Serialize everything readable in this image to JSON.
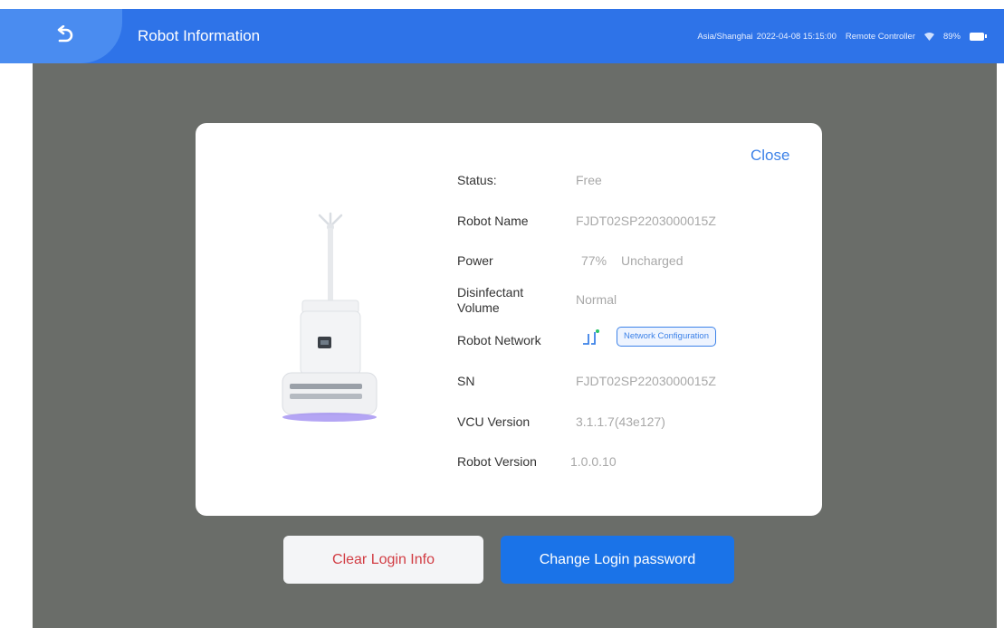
{
  "header": {
    "title": "Robot Information",
    "timezone": "Asia/Shanghai",
    "datetime": "2022-04-08 15:15:00",
    "controller": "Remote Controller",
    "battery": "89%"
  },
  "dialog": {
    "close_label": "Close",
    "status": {
      "label": "Status:",
      "value": "Free"
    },
    "robot_name": {
      "label": "Robot Name",
      "value": "FJDT02SP2203000015Z"
    },
    "power": {
      "label": "Power",
      "value": "77%",
      "charge_state": "Uncharged"
    },
    "disinfectant": {
      "label": "Disinfectant Volume",
      "label_line1": "Disinfectant",
      "label_line2": "Volume",
      "value": "Normal"
    },
    "network": {
      "label": "Robot Network",
      "config_button": "Network Configuration"
    },
    "sn": {
      "label": "SN",
      "value": "FJDT02SP2203000015Z"
    },
    "vcu_version": {
      "label": "VCU Version",
      "value": "3.1.1.7(43e127)"
    },
    "robot_version": {
      "label": "Robot Version",
      "value": "1.0.0.10"
    }
  },
  "actions": {
    "clear_login": "Clear Login Info",
    "change_password": "Change Login password"
  },
  "colors": {
    "header_bg": "#2e73e8",
    "accent": "#1a73e8",
    "danger_text": "#d23d44",
    "overlay": "#6a6d69"
  },
  "icons": {
    "back": "undo-arrow-icon",
    "wifi": "wifi-icon",
    "battery": "battery-icon",
    "network_status": "network-signal-icon"
  }
}
